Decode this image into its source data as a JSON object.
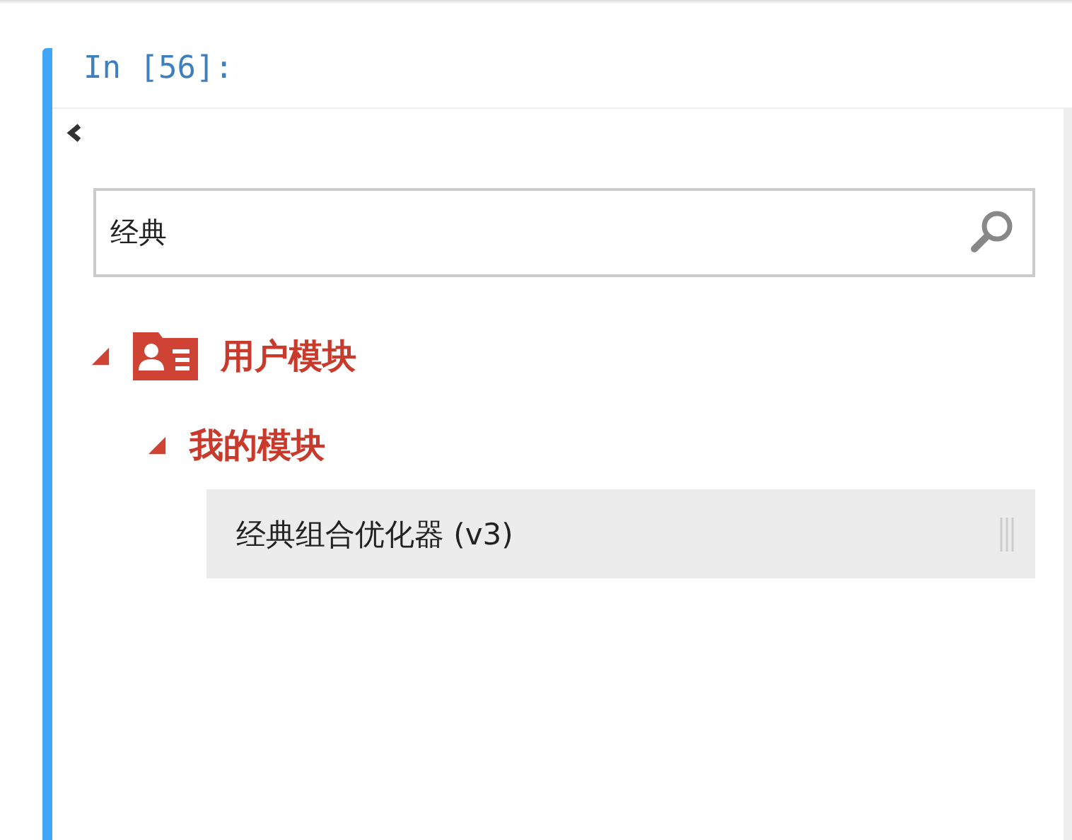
{
  "cell": {
    "prompt": "In [56]:"
  },
  "search": {
    "value": "经典"
  },
  "tree": [
    {
      "kind": "user-folder",
      "label": "用户模块",
      "expanded": true,
      "children": [
        {
          "label": "我的模块",
          "expanded": true,
          "children": [
            {
              "kind": "module",
              "label": "经典组合优化器 (v3)",
              "selected": true
            }
          ]
        }
      ]
    }
  ]
}
